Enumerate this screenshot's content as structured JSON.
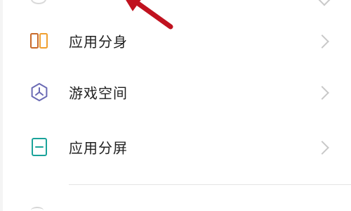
{
  "settings_list": {
    "items": [
      {
        "label": "应用分身",
        "icon": "app-clone-icon"
      },
      {
        "label": "游戏空间",
        "icon": "game-space-icon"
      },
      {
        "label": "应用分屏",
        "icon": "split-screen-icon"
      }
    ]
  },
  "colors": {
    "app_clone_orange": "#e8832e",
    "app_clone_brown": "#c96a2a",
    "game_space_purple": "#6a6ab4",
    "split_screen_teal": "#1aa39a",
    "arrow_red": "#c0121f",
    "chevron_gray": "#c8c8c8",
    "divider": "#e5e5e5"
  },
  "annotation": {
    "type": "red-arrow"
  }
}
